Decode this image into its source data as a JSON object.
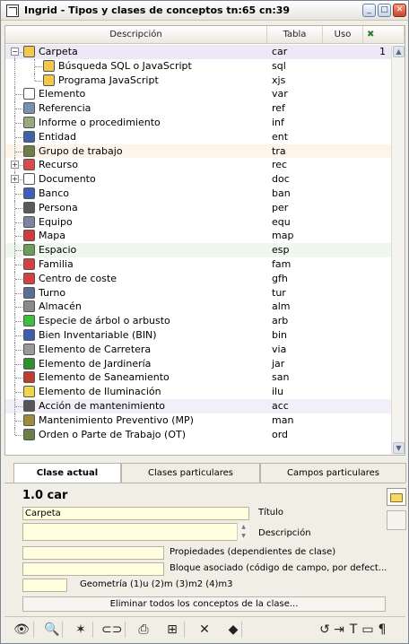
{
  "window": {
    "title": "Ingrid - Tipos y clases de conceptos tn:65 cn:39"
  },
  "grid": {
    "columns": {
      "desc": "Descripción",
      "tabla": "Tabla",
      "uso": "Uso",
      "extra": ""
    },
    "rows": [
      {
        "label": "Carpeta",
        "code": "car",
        "uso": "1",
        "icon": "folder-icon",
        "color": "#f2c94c"
      },
      {
        "label": "Búsqueda SQL o JavaScript",
        "code": "sql",
        "uso": "",
        "icon": "search-doc-icon",
        "color": "#f2c94c"
      },
      {
        "label": "Programa JavaScript",
        "code": "xjs",
        "uso": "",
        "icon": "script-icon",
        "color": "#f2c94c"
      },
      {
        "label": "Elemento",
        "code": "var",
        "uso": "",
        "icon": "document-icon",
        "color": "#ffffff"
      },
      {
        "label": "Referencia",
        "code": "ref",
        "uso": "",
        "icon": "reference-icon",
        "color": "#7b8fb5"
      },
      {
        "label": "Informe o procedimiento",
        "code": "inf",
        "uso": "",
        "icon": "report-icon",
        "color": "#9aa97b"
      },
      {
        "label": "Entidad",
        "code": "ent",
        "uso": "",
        "icon": "entity-icon",
        "color": "#3f63a8"
      },
      {
        "label": "Grupo de trabajo",
        "code": "tra",
        "uso": "",
        "icon": "workgroup-icon",
        "color": "#6b7f47"
      },
      {
        "label": "Recurso",
        "code": "rec",
        "uso": "",
        "icon": "resource-icon",
        "color": "#d84c4c"
      },
      {
        "label": "Documento",
        "code": "doc",
        "uso": "",
        "icon": "document-icon",
        "color": "#ffffff"
      },
      {
        "label": "Banco",
        "code": "ban",
        "uso": "",
        "icon": "bank-icon",
        "color": "#3c5fb8"
      },
      {
        "label": "Persona",
        "code": "per",
        "uso": "",
        "icon": "person-icon",
        "color": "#5a5a5a"
      },
      {
        "label": "Equipo",
        "code": "equ",
        "uso": "",
        "icon": "computer-icon",
        "color": "#7d85a0"
      },
      {
        "label": "Mapa",
        "code": "map",
        "uso": "",
        "icon": "map-icon",
        "color": "#d23b3b"
      },
      {
        "label": "Espacio",
        "code": "esp",
        "uso": "",
        "icon": "space-icon",
        "color": "#6f9b5a"
      },
      {
        "label": "Familia",
        "code": "fam",
        "uso": "",
        "icon": "family-icon",
        "color": "#d74040"
      },
      {
        "label": "Centro de coste",
        "code": "gfh",
        "uso": "",
        "icon": "cost-center-icon",
        "color": "#d74040"
      },
      {
        "label": "Turno",
        "code": "tur",
        "uso": "",
        "icon": "calendar-icon",
        "color": "#5d6e96"
      },
      {
        "label": "Almacén",
        "code": "alm",
        "uso": "",
        "icon": "warehouse-icon",
        "color": "#8a8a8a"
      },
      {
        "label": "Especie de árbol o arbusto",
        "code": "arb",
        "uso": "",
        "icon": "leaf-icon",
        "color": "#3cbf3c"
      },
      {
        "label": "Bien Inventariable (BIN)",
        "code": "bin",
        "uso": "",
        "icon": "inventory-icon",
        "color": "#3e5dae"
      },
      {
        "label": "Elemento de Carretera",
        "code": "via",
        "uso": "",
        "icon": "road-icon",
        "color": "#9a9a9a"
      },
      {
        "label": "Elemento de Jardinería",
        "code": "jar",
        "uso": "",
        "icon": "tree-icon",
        "color": "#2f8f2f"
      },
      {
        "label": "Elemento de Saneamiento",
        "code": "san",
        "uso": "",
        "icon": "sanitation-icon",
        "color": "#c23c2c"
      },
      {
        "label": "Elemento de Iluminación",
        "code": "ilu",
        "uso": "",
        "icon": "bulb-icon",
        "color": "#f0d64a"
      },
      {
        "label": "Acción de mantenimiento",
        "code": "acc",
        "uso": "",
        "icon": "wrench-icon",
        "color": "#555555"
      },
      {
        "label": "Mantenimiento Preventivo (MP)",
        "code": "man",
        "uso": "",
        "icon": "maintenance-icon",
        "color": "#a08a3c"
      },
      {
        "label": "Orden o Parte de Trabajo (OT)",
        "code": "ord",
        "uso": "",
        "icon": "work-order-icon",
        "color": "#6b7f47"
      }
    ]
  },
  "tabs": [
    "Clase actual",
    "Clases particulares",
    "Campos particulares"
  ],
  "current": {
    "header": "1.0 car",
    "titulo_value": "Carpeta",
    "titulo_label": "Título",
    "descripcion_label": "Descripción",
    "propiedades_label": "Propiedades (dependientes de clase)",
    "bloque_label": "Bloque asociado (código de campo, por defect...",
    "geometria_label": "Geometría (1)u (2)m (3)m2 (4)m3",
    "eliminar_label": "Eliminar todos los conceptos de la clase..."
  },
  "toolbar": {
    "buttons": [
      "binoculars-icon",
      "open-search-icon",
      "star-icon",
      "link-icon",
      "print-icon",
      "tree-view-icon",
      "delete-icon",
      "book-icon",
      "refresh-icon",
      "export-icon",
      "text-icon",
      "comment-icon",
      "paragraph-icon"
    ]
  },
  "colors": {
    "accent": "#3c5fb8",
    "field_bg": "#ffffe0",
    "selected_row": "#ece8f5"
  }
}
